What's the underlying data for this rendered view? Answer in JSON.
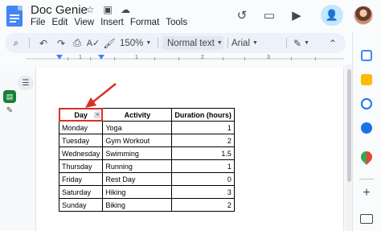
{
  "doc": {
    "title": "Doc Genie"
  },
  "menu": [
    "File",
    "Edit",
    "View",
    "Insert",
    "Format",
    "Tools"
  ],
  "toolbar": {
    "zoom": "150%",
    "style": "Normal text",
    "font": "Arial"
  },
  "table": {
    "headers": [
      "Day",
      "Activity",
      "Duration (hours)"
    ],
    "rows": [
      [
        "Monday",
        "Yoga",
        "1"
      ],
      [
        "Tuesday",
        "Gym Workout",
        "2"
      ],
      [
        "Wednesday",
        "Swimming",
        "1.5"
      ],
      [
        "Thursday",
        "Running",
        "1"
      ],
      [
        "Friday",
        "Rest Day",
        "0"
      ],
      [
        "Saturday",
        "Hiking",
        "3"
      ],
      [
        "Sunday",
        "Biking",
        "2"
      ]
    ]
  },
  "ruler": {
    "labels": [
      "1",
      "1",
      "2",
      "3"
    ]
  },
  "colors": {
    "accent": "#4285f4",
    "highlight": "#d93025",
    "share": "#c2e7ff"
  },
  "icons": [
    "docs-icon",
    "star-icon",
    "move-folder-icon",
    "cloud-saved-icon",
    "history-icon",
    "comment-icon",
    "video-call-icon",
    "share-person-icon"
  ]
}
